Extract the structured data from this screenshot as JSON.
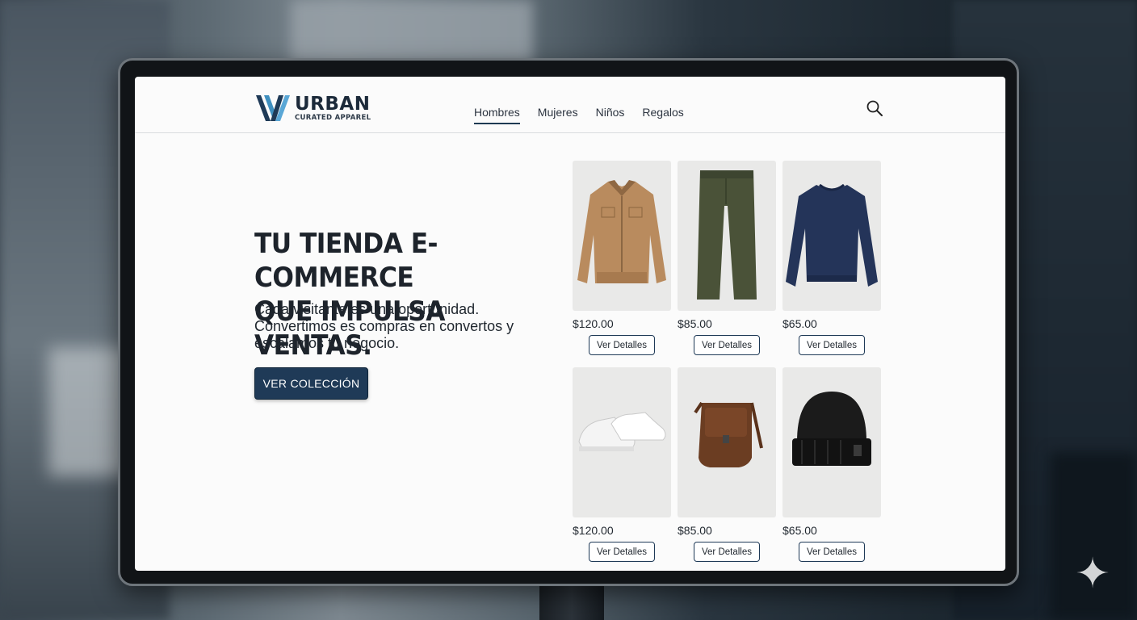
{
  "brand": {
    "name": "URBAN",
    "tagline": "CURATED APPAREL"
  },
  "nav": {
    "items": [
      {
        "label": "Hombres",
        "active": true
      },
      {
        "label": "Mujeres",
        "active": false
      },
      {
        "label": "Niños",
        "active": false
      },
      {
        "label": "Regalos",
        "active": false
      }
    ]
  },
  "hero": {
    "title_line1": "TU TIENDA E-COMMERCE",
    "title_line2": "QUE IMPULSA VENTAS.",
    "subtitle": "Cada visitante es una oportunidad. Convertimos es compras en convertos y escalamos tu negocio.",
    "cta_label": "VER COLECCIÓN"
  },
  "products": [
    {
      "image": "tan-jacket",
      "price": "$120.00",
      "button": "Ver Detalles"
    },
    {
      "image": "olive-pants",
      "price": "$85.00",
      "button": "Ver Detalles"
    },
    {
      "image": "navy-sweatshirt",
      "price": "$65.00",
      "button": "Ver Detalles"
    },
    {
      "image": "white-sneakers",
      "price": "$120.00",
      "button": "Ver Detalles"
    },
    {
      "image": "leather-bag",
      "price": "$85.00",
      "button": "Ver Detalles"
    },
    {
      "image": "black-beanie",
      "price": "$65.00",
      "button": "Ver Detalles"
    }
  ],
  "colors": {
    "accent": "#1f3a57",
    "text": "#1d232b",
    "card_bg": "#e9e9e8"
  },
  "icons": {
    "search": "search-icon",
    "sparkle": "sparkle-icon"
  }
}
